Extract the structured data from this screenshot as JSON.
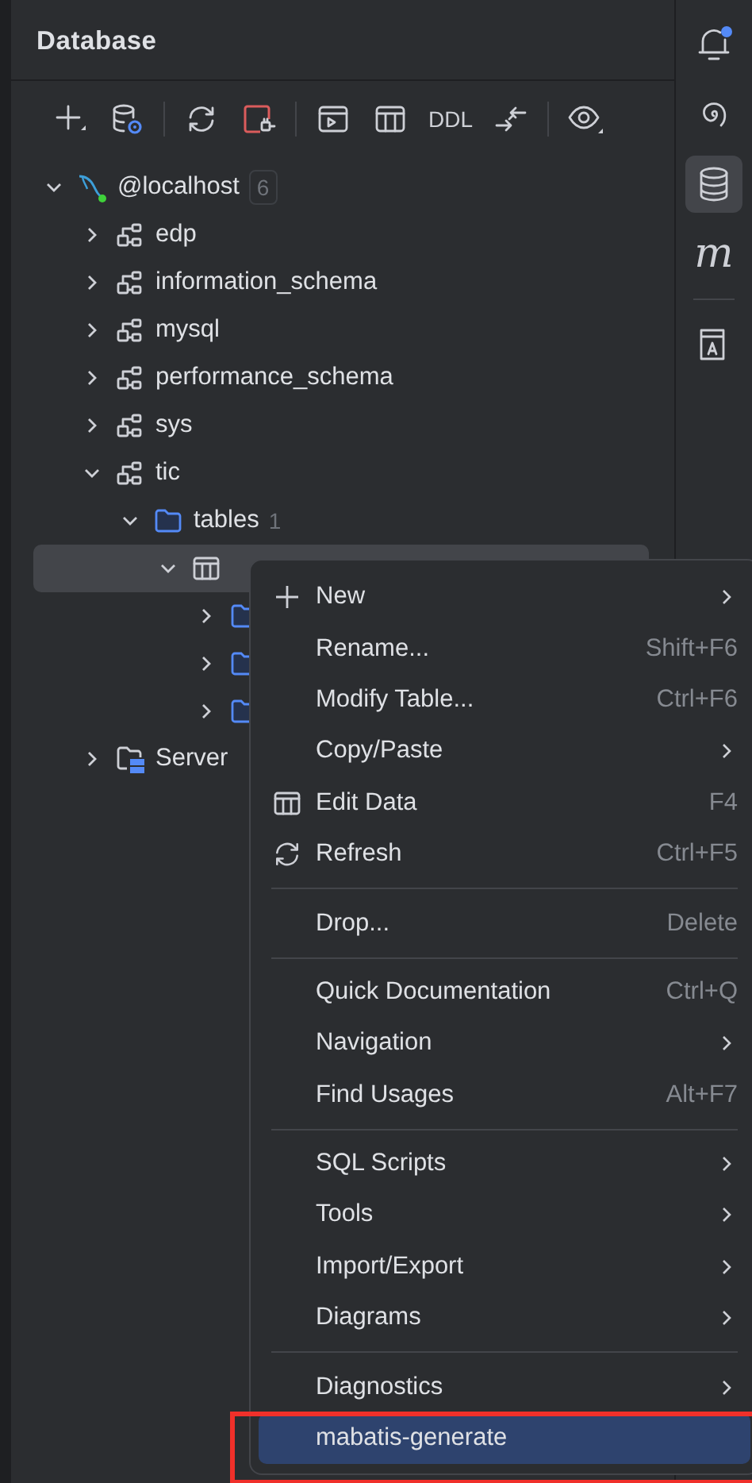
{
  "panel": {
    "title": "Database"
  },
  "toolbar": [
    {
      "kind": "add"
    },
    {
      "kind": "datasource-settings"
    },
    {
      "kind": "refresh"
    },
    {
      "kind": "disconnect"
    },
    {
      "kind": "console"
    },
    {
      "kind": "table"
    },
    {
      "kind": "text",
      "label": "DDL"
    },
    {
      "kind": "compare"
    },
    {
      "kind": "view"
    }
  ],
  "tree": [
    {
      "kind": "datasource",
      "label": "@localhost",
      "count": "6",
      "expanded": true,
      "selected": false,
      "children": [
        {
          "kind": "schema",
          "label": "edp",
          "expanded": false,
          "selected": false
        },
        {
          "kind": "schema",
          "label": "information_schema",
          "expanded": false,
          "selected": false
        },
        {
          "kind": "schema",
          "label": "mysql",
          "expanded": false,
          "selected": false
        },
        {
          "kind": "schema",
          "label": "performance_schema",
          "expanded": false,
          "selected": false
        },
        {
          "kind": "schema",
          "label": "sys",
          "expanded": false,
          "selected": false
        },
        {
          "kind": "schema",
          "label": "tic",
          "expanded": true,
          "selected": false,
          "children": [
            {
              "kind": "folder",
              "label": "tables",
              "count": "1",
              "expanded": true,
              "selected": false,
              "children": [
                {
                  "kind": "table",
                  "expanded": true,
                  "selected": true,
                  "children": [
                    {
                      "kind": "folder",
                      "expanded": false,
                      "selected": false
                    },
                    {
                      "kind": "folder",
                      "expanded": false,
                      "selected": false
                    },
                    {
                      "kind": "folder",
                      "expanded": false,
                      "selected": false
                    }
                  ]
                }
              ]
            }
          ]
        },
        {
          "kind": "server",
          "label": "Server",
          "expanded": false,
          "selected": false
        }
      ]
    }
  ],
  "side_toolbar": [
    {
      "kind": "notifications",
      "badge": true,
      "selected": false
    },
    {
      "kind": "spiral",
      "selected": false
    },
    {
      "kind": "database",
      "selected": true
    },
    {
      "kind": "letter",
      "label": "m",
      "selected": false
    },
    {
      "kind": "separator"
    },
    {
      "kind": "document",
      "selected": false
    }
  ],
  "context_menu": {
    "items": [
      {
        "kind": "new",
        "label": "New",
        "submenu": true,
        "selected": false
      },
      {
        "kind": "item",
        "label": "Rename...",
        "shortcut": "Shift+F6",
        "selected": false
      },
      {
        "kind": "item",
        "label": "Modify Table...",
        "shortcut": "Ctrl+F6",
        "selected": false
      },
      {
        "kind": "item",
        "label": "Copy/Paste",
        "submenu": true,
        "selected": false
      },
      {
        "kind": "edit-data",
        "label": "Edit Data",
        "shortcut": "F4",
        "selected": false
      },
      {
        "kind": "refresh",
        "label": "Refresh",
        "shortcut": "Ctrl+F5",
        "selected": false
      },
      {
        "kind": "separator"
      },
      {
        "kind": "item",
        "label": "Drop...",
        "shortcut": "Delete",
        "selected": false
      },
      {
        "kind": "separator"
      },
      {
        "kind": "item",
        "label": "Quick Documentation",
        "shortcut": "Ctrl+Q",
        "selected": false
      },
      {
        "kind": "item",
        "label": "Navigation",
        "submenu": true,
        "selected": false
      },
      {
        "kind": "item",
        "label": "Find Usages",
        "shortcut": "Alt+F7",
        "selected": false
      },
      {
        "kind": "separator"
      },
      {
        "kind": "item",
        "label": "SQL Scripts",
        "submenu": true,
        "selected": false
      },
      {
        "kind": "item",
        "label": "Tools",
        "submenu": true,
        "selected": false
      },
      {
        "kind": "item",
        "label": "Import/Export",
        "submenu": true,
        "selected": false
      },
      {
        "kind": "item",
        "label": "Diagrams",
        "submenu": true,
        "selected": false
      },
      {
        "kind": "separator"
      },
      {
        "kind": "item",
        "label": "Diagnostics",
        "submenu": true,
        "selected": false
      },
      {
        "kind": "item",
        "label": "mabatis-generate",
        "selected": true,
        "highlighted": true
      }
    ]
  }
}
